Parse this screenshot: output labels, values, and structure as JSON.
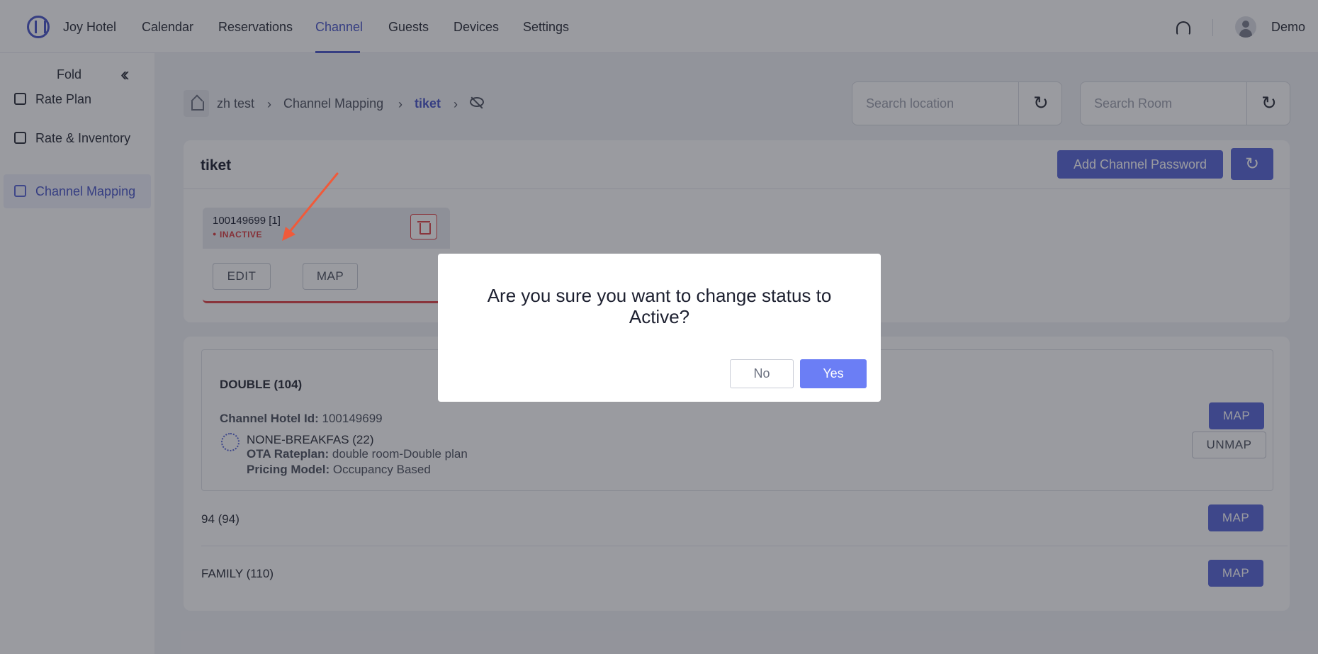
{
  "header": {
    "brand": "Joy Hotel",
    "nav": [
      {
        "label": "Calendar"
      },
      {
        "label": "Reservations"
      },
      {
        "label": "Channel",
        "active": true
      },
      {
        "label": "Guests"
      },
      {
        "label": "Devices"
      },
      {
        "label": "Settings"
      }
    ],
    "user": "Demo",
    "icons": {
      "logo": "hotel-logo-icon",
      "support": "headset-icon",
      "avatar": "user-avatar-icon"
    }
  },
  "sidebar": {
    "fold_label": "Fold",
    "fold_icon": "double-chevron-left-icon",
    "items": [
      {
        "label": "Rate Plan",
        "icon": "rate-plan-icon"
      },
      {
        "label": "Rate & Inventory",
        "icon": "rate-inventory-icon"
      },
      {
        "label": "Channel Mapping",
        "icon": "channel-mapping-icon",
        "active": true
      }
    ]
  },
  "breadcrumb": {
    "items": [
      "zh test",
      "Channel Mapping",
      "tiket"
    ],
    "icons": {
      "home": "home-icon",
      "separator": "chevron-right-icon",
      "visibility": "eye-off-icon"
    }
  },
  "search": {
    "location_placeholder": "Search location",
    "room_placeholder": "Search Room"
  },
  "channel": {
    "title": "tiket",
    "add_password_label": "Add Channel Password",
    "account": {
      "id": "100149699 [1]",
      "status": "INACTIVE",
      "edit_label": "EDIT",
      "map_label": "MAP"
    }
  },
  "rooms": {
    "mapped": {
      "name": "DOUBLE (104)",
      "hotel_id_label": "Channel Hotel Id:",
      "hotel_id": "100149699",
      "map_label": "MAP",
      "unmap_label": "UNMAP",
      "rate": {
        "name": "NONE-BREAKFAS (22)",
        "ota_label": "OTA Rateplan:",
        "ota_value": "double room-Double plan",
        "pricing_label": "Pricing Model:",
        "pricing_value": "Occupancy Based"
      }
    },
    "others": [
      {
        "name": "94 (94)",
        "map_label": "MAP"
      },
      {
        "name": "FAMILY (110)",
        "map_label": "MAP"
      }
    ]
  },
  "modal": {
    "message": "Are you sure you want to change status to Active?",
    "no_label": "No",
    "yes_label": "Yes"
  },
  "colors": {
    "accent": "#4a57c9",
    "primary_button": "#5866d8",
    "inactive": "#d93c41",
    "yes_button": "#6b7ef5",
    "annotation_arrow": "#f05a3a"
  }
}
